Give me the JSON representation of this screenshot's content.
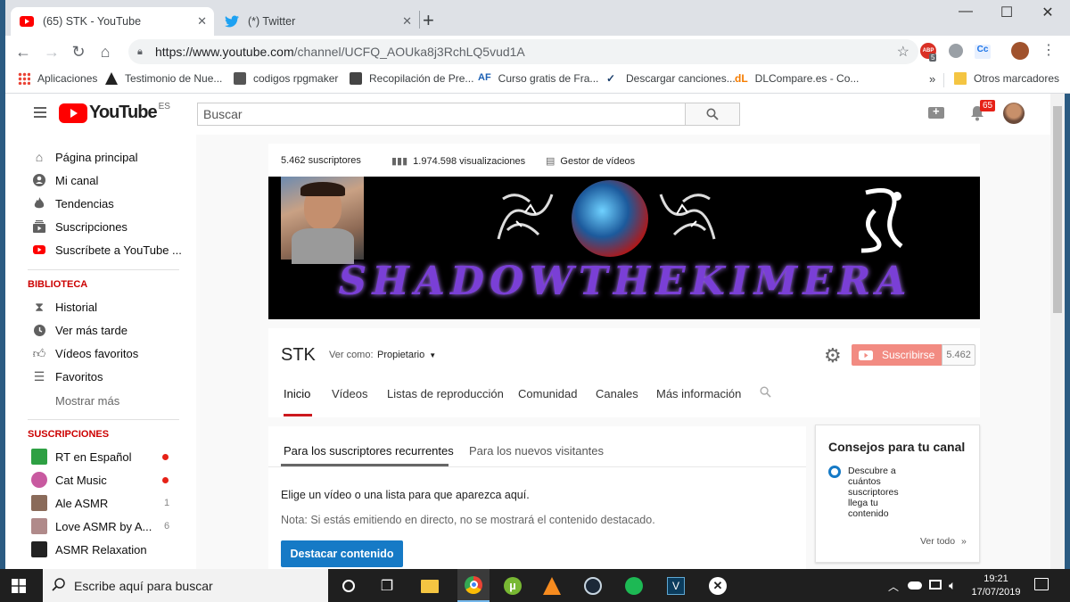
{
  "browser": {
    "tabs": [
      {
        "title": "(65) STK - YouTube",
        "icon": "youtube-icon"
      },
      {
        "title": "(*) Twitter",
        "icon": "twitter-icon"
      }
    ],
    "new_tab": "+",
    "window_controls": {
      "minimize": "—",
      "maximize": "☐",
      "close": "✕"
    },
    "url_host": "https://www.youtube.com",
    "url_path": "/channel/UCFQ_AOUka8j3RchLQ5vud1A",
    "extensions": {
      "abp_badge": "ABP",
      "abp_count": "5",
      "cc": "Cc"
    },
    "bookmarks": [
      "Aplicaciones",
      "Testimonio de Nue...",
      "codigos rpgmaker",
      "Recopilación de Pre...",
      "Curso gratis de Fra...",
      "Descargar canciones...",
      "DLCompare.es - Co..."
    ],
    "bookmarks_overflow": "»",
    "other_bookmarks": "Otros marcadores"
  },
  "youtube": {
    "logo_text": "YouTube",
    "region": "ES",
    "search_placeholder": "Buscar",
    "notification_count": "65",
    "sidebar": {
      "main_items": [
        {
          "label": "Página principal",
          "icon": "home-icon"
        },
        {
          "label": "Mi canal",
          "icon": "account-icon"
        },
        {
          "label": "Tendencias",
          "icon": "flame-icon"
        },
        {
          "label": "Suscripciones",
          "icon": "subscriptions-icon"
        },
        {
          "label": "Suscríbete a YouTube ...",
          "icon": "youtube-red-icon"
        }
      ],
      "library_heading": "BIBLIOTECA",
      "library_items": [
        {
          "label": "Historial",
          "icon": "hourglass-icon"
        },
        {
          "label": "Ver más tarde",
          "icon": "clock-icon"
        },
        {
          "label": "Vídeos favoritos",
          "icon": "thumbs-up-icon"
        },
        {
          "label": "Favoritos",
          "icon": "playlist-icon"
        }
      ],
      "show_more": "Mostrar más",
      "subs_heading": "SUSCRIPCIONES",
      "subscriptions": [
        {
          "label": "RT en Español",
          "badge": "dot",
          "color": "#2ea043"
        },
        {
          "label": "Cat Music",
          "badge": "dot",
          "color": "#c85aa0"
        },
        {
          "label": "Ale ASMR",
          "badge": "1",
          "color": "#8a6b5a"
        },
        {
          "label": "Love ASMR by A...",
          "badge": "6",
          "color": "#b08a8a"
        },
        {
          "label": "ASMR Relaxation",
          "badge": "",
          "color": "#222222"
        }
      ]
    },
    "channel": {
      "subscribers_stat": "5.462 suscriptores",
      "views_stat": "1.974.598 visualizaciones",
      "manager": "Gestor de vídeos",
      "banner_text": "SHADOWTHEKIMERA",
      "name": "STK",
      "view_as_label": "Ver como:",
      "view_as_value": "Propietario",
      "subscribe_label": "Suscribirse",
      "subscribe_count": "5.462",
      "tabs": [
        "Inicio",
        "Vídeos",
        "Listas de reproducción",
        "Comunidad",
        "Canales",
        "Más información"
      ],
      "active_tab": "Inicio"
    },
    "featured": {
      "subtabs": [
        "Para los suscriptores recurrentes",
        "Para los nuevos visitantes"
      ],
      "prompt": "Elige un vídeo o una lista para que aparezca aquí.",
      "note": "Nota: Si estás emitiendo en directo, no se mostrará el contenido destacado.",
      "button": "Destacar contenido"
    },
    "tips": {
      "title": "Consejos para tu canal",
      "item_lines": [
        "Descubre a",
        "cuántos",
        "suscriptores",
        "llega tu",
        "contenido"
      ],
      "see_all": "Ver todo",
      "see_all_arrow": "»"
    }
  },
  "taskbar": {
    "search_placeholder": "Escribe aquí para buscar",
    "time": "19:21",
    "date": "17/07/2019",
    "apps": [
      "task-view-icon",
      "file-explorer-icon",
      "chrome-icon",
      "utorrent-icon",
      "vlc-icon",
      "steam-icon",
      "spotify-icon",
      "vegas-icon",
      "xbox-icon"
    ]
  }
}
